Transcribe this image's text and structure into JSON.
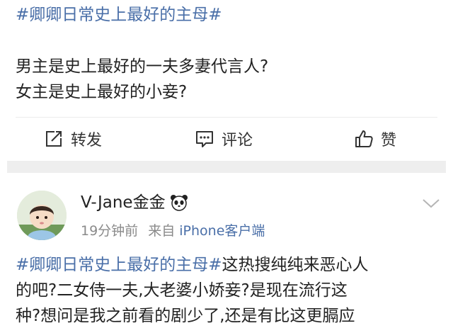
{
  "post1": {
    "hashtag": "#卿卿日常史上最好的主母#",
    "lines": [
      "男主是史上最好的一夫多妻代言人?",
      "女主是史上最好的小妾?"
    ],
    "actions": {
      "forward_label": "转发",
      "comment_label": "评论",
      "like_label": "赞"
    }
  },
  "post2": {
    "username": "V-Jane金金",
    "time": "19分钟前",
    "source_prefix": "来自",
    "source_app": "iPhone客户端",
    "hashtag": "#卿卿日常史上最好的主母#",
    "line1_rest": "这热搜纯纯来恶心人",
    "line2": "的吧?二女侍一夫,大老婆小娇妾?是现在流行这",
    "line3": "种?想问是我之前看的剧少了,还是有比这更膈应"
  },
  "colors": {
    "link": "#4a6fa8",
    "text": "#222222",
    "muted": "#8a8a8a",
    "band": "#eeeeee"
  },
  "icons": {
    "forward": "share-edit-icon",
    "comment": "comment-icon",
    "like": "thumbs-up-icon",
    "badge": "panda-icon",
    "menu": "chevron-down-icon"
  }
}
